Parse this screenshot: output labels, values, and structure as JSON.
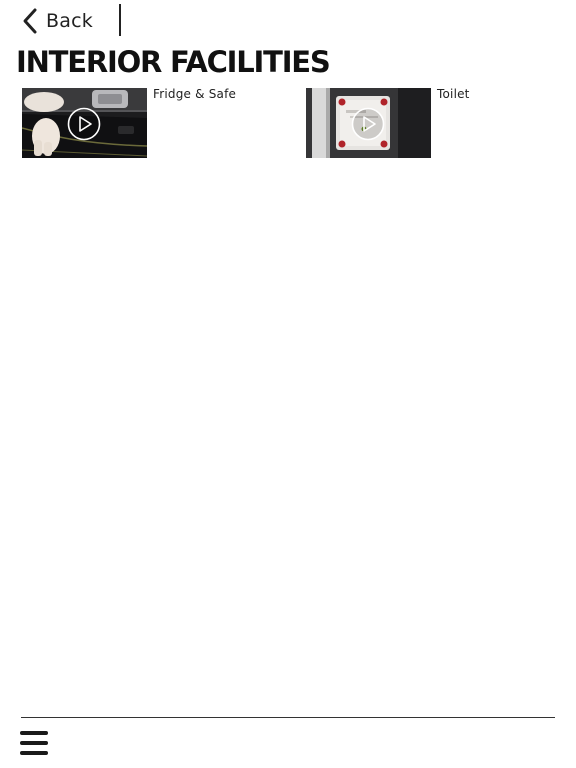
{
  "header": {
    "back_label": "Back",
    "back_icon": "chevron-left-icon"
  },
  "page": {
    "title": "INTERIOR FACILITIES"
  },
  "videos": [
    {
      "label": "Fridge & Safe",
      "icon": "play-icon"
    },
    {
      "label": "Toilet",
      "icon": "play-icon"
    }
  ],
  "footer": {
    "menu_icon": "hamburger-menu-icon"
  },
  "colors": {
    "text": "#111111",
    "divider": "#333333",
    "background": "#ffffff"
  }
}
